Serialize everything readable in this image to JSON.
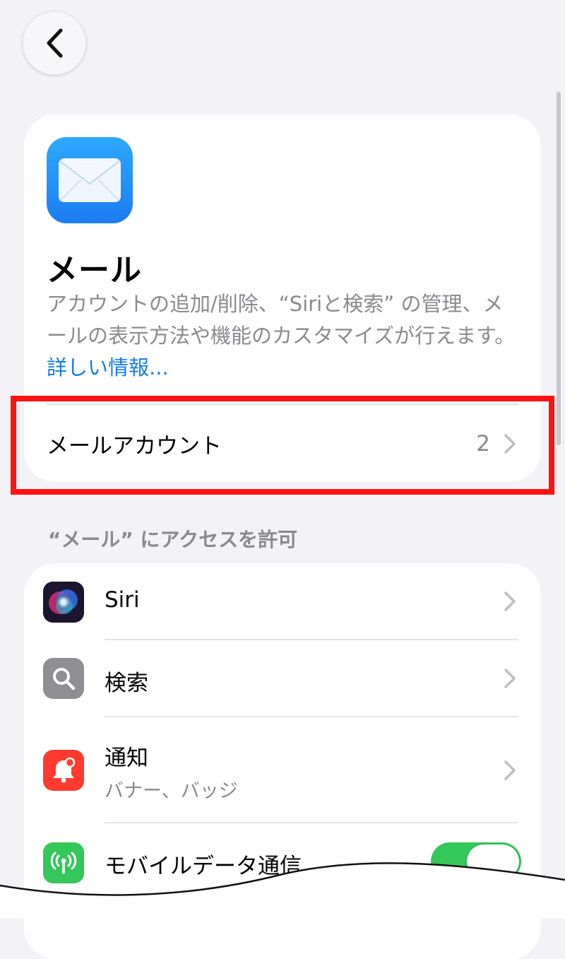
{
  "header": {
    "back_icon": "chevron-left-icon"
  },
  "app": {
    "icon": "mail-icon",
    "title": "メール",
    "description": "アカウントの追加/削除、“Siriと検索” の管理、メールの表示方法や機能のカスタマイズが行えます。",
    "more_link": "詳しい情報..."
  },
  "account_row": {
    "label": "メールアカウント",
    "count": "2"
  },
  "access_section": {
    "header": "“メール” にアクセスを許可",
    "items": [
      {
        "label": "Siri",
        "icon": "siri-icon"
      },
      {
        "label": "検索",
        "icon": "search-icon"
      },
      {
        "label": "通知",
        "subtitle": "バナー、バッジ",
        "icon": "notification-bell-icon"
      },
      {
        "label": "モバイルデータ通信",
        "icon": "antenna-icon",
        "toggle_on": true
      }
    ]
  },
  "colors": {
    "background": "#f2f2f7",
    "card": "#ffffff",
    "link": "#147ce5",
    "toggle_on": "#34c759",
    "highlight": "#ff1212",
    "secondary_text": "#8a8a8e"
  }
}
